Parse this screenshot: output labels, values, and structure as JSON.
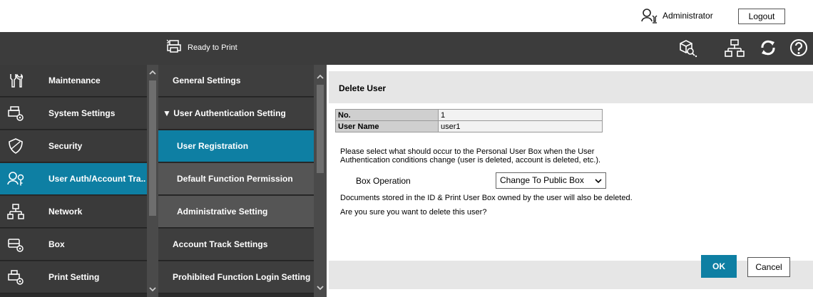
{
  "topbar": {
    "user_label": "Administrator",
    "logout_label": "Logout"
  },
  "header": {
    "status_label": "Ready to Print"
  },
  "left_nav": {
    "items": [
      {
        "label": "Maintenance",
        "icon": "maintenance-icon"
      },
      {
        "label": "System Settings",
        "icon": "system-settings-icon"
      },
      {
        "label": "Security",
        "icon": "security-shield-icon"
      },
      {
        "label": "User Auth/Account Tra..",
        "icon": "user-auth-icon"
      },
      {
        "label": "Network",
        "icon": "network-icon"
      },
      {
        "label": "Box",
        "icon": "box-icon"
      },
      {
        "label": "Print Setting",
        "icon": "print-setting-icon"
      }
    ]
  },
  "mid_nav": {
    "items": [
      {
        "label": "General Settings"
      },
      {
        "label": "▼ User Authentication Setting"
      },
      {
        "label": "User Registration"
      },
      {
        "label": "Default Function Permission"
      },
      {
        "label": "Administrative Setting"
      },
      {
        "label": "Account Track Settings"
      },
      {
        "label": "Prohibited Function Login Setting"
      }
    ]
  },
  "content": {
    "title": "Delete User",
    "table": [
      {
        "key": "No.",
        "value": "1"
      },
      {
        "key": "User Name",
        "value": "user1"
      }
    ],
    "prompt_line1": "Please select what should occur to the Personal User Box when the User",
    "prompt_line2": "Authentication conditions change (user is deleted, account is deleted, etc.).",
    "box_operation_label": "Box Operation",
    "box_operation_value": "Change To Public Box",
    "note": "Documents stored in the ID & Print User Box owned by the user will also be deleted.",
    "confirm": "Are you sure you want to delete this user?",
    "ok_label": "OK",
    "cancel_label": "Cancel"
  },
  "colors": {
    "accent": "#0e7fa3",
    "header_bg": "#3c3c3c",
    "nav_bg": "#3a3a3a"
  }
}
